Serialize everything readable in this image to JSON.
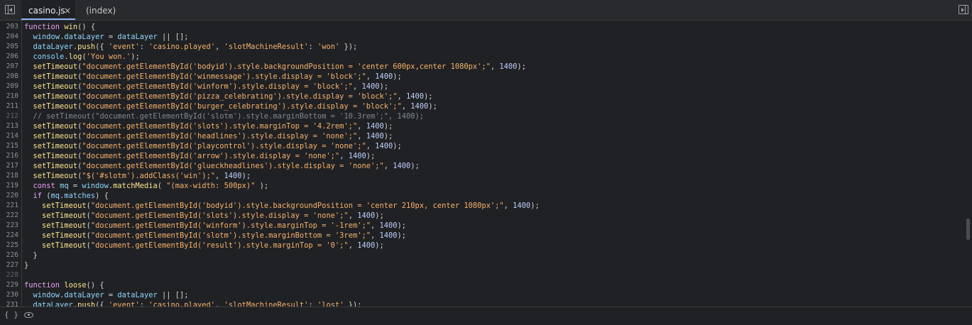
{
  "tabs": {
    "active": {
      "label": "casino.js",
      "close_glyph": "×"
    },
    "second": {
      "label": "(index)"
    }
  },
  "icons": {
    "left_panel_toggle": "left-panel-toggle-icon",
    "right_panel_toggle": "right-panel-toggle-icon",
    "braces": "braces-icon",
    "eye": "eye-icon"
  },
  "status": {
    "braces_glyph": "{ }"
  },
  "code": {
    "lines": [
      {
        "num": "203",
        "segments": [
          {
            "t": "function",
            "c": "kw"
          },
          {
            "t": " ",
            "c": "punc"
          },
          {
            "t": "win",
            "c": "fn"
          },
          {
            "t": "() {",
            "c": "punc"
          }
        ]
      },
      {
        "num": "204",
        "segments": [
          {
            "t": "  ",
            "c": "punc"
          },
          {
            "t": "window",
            "c": "prop"
          },
          {
            "t": ".",
            "c": "punc"
          },
          {
            "t": "dataLayer",
            "c": "prop"
          },
          {
            "t": " = ",
            "c": "punc"
          },
          {
            "t": "dataLayer",
            "c": "prop"
          },
          {
            "t": " || [];",
            "c": "punc"
          }
        ]
      },
      {
        "num": "205",
        "segments": [
          {
            "t": "  ",
            "c": "punc"
          },
          {
            "t": "dataLayer",
            "c": "prop"
          },
          {
            "t": ".",
            "c": "punc"
          },
          {
            "t": "push",
            "c": "fn"
          },
          {
            "t": "({ ",
            "c": "punc"
          },
          {
            "t": "'event'",
            "c": "str"
          },
          {
            "t": ": ",
            "c": "punc"
          },
          {
            "t": "'casino.played'",
            "c": "str"
          },
          {
            "t": ", ",
            "c": "punc"
          },
          {
            "t": "'slotMachineResult'",
            "c": "str"
          },
          {
            "t": ": ",
            "c": "punc"
          },
          {
            "t": "'won'",
            "c": "str"
          },
          {
            "t": " });",
            "c": "punc"
          }
        ]
      },
      {
        "num": "206",
        "segments": [
          {
            "t": "  ",
            "c": "punc"
          },
          {
            "t": "console",
            "c": "prop"
          },
          {
            "t": ".",
            "c": "punc"
          },
          {
            "t": "log",
            "c": "fn"
          },
          {
            "t": "(",
            "c": "punc"
          },
          {
            "t": "'You won.'",
            "c": "str"
          },
          {
            "t": ");",
            "c": "punc"
          }
        ]
      },
      {
        "num": "207",
        "segments": [
          {
            "t": "  ",
            "c": "punc"
          },
          {
            "t": "setTimeout",
            "c": "fn"
          },
          {
            "t": "(",
            "c": "punc"
          },
          {
            "t": "\"document.getElementById('bodyid').style.backgroundPosition = 'center 600px,center 1080px';\"",
            "c": "str"
          },
          {
            "t": ", ",
            "c": "punc"
          },
          {
            "t": "1400",
            "c": "num"
          },
          {
            "t": ");",
            "c": "punc"
          }
        ]
      },
      {
        "num": "208",
        "segments": [
          {
            "t": "  ",
            "c": "punc"
          },
          {
            "t": "setTimeout",
            "c": "fn"
          },
          {
            "t": "(",
            "c": "punc"
          },
          {
            "t": "\"document.getElementById('winmessage').style.display = 'block';\"",
            "c": "str"
          },
          {
            "t": ", ",
            "c": "punc"
          },
          {
            "t": "1400",
            "c": "num"
          },
          {
            "t": ");",
            "c": "punc"
          }
        ]
      },
      {
        "num": "209",
        "segments": [
          {
            "t": "  ",
            "c": "punc"
          },
          {
            "t": "setTimeout",
            "c": "fn"
          },
          {
            "t": "(",
            "c": "punc"
          },
          {
            "t": "\"document.getElementById('winform').style.display = 'block';\"",
            "c": "str"
          },
          {
            "t": ", ",
            "c": "punc"
          },
          {
            "t": "1400",
            "c": "num"
          },
          {
            "t": ");",
            "c": "punc"
          }
        ]
      },
      {
        "num": "210",
        "segments": [
          {
            "t": "  ",
            "c": "punc"
          },
          {
            "t": "setTimeout",
            "c": "fn"
          },
          {
            "t": "(",
            "c": "punc"
          },
          {
            "t": "\"document.getElementById('pizza_celebrating').style.display = 'block';\"",
            "c": "str"
          },
          {
            "t": ", ",
            "c": "punc"
          },
          {
            "t": "1400",
            "c": "num"
          },
          {
            "t": ");",
            "c": "punc"
          }
        ]
      },
      {
        "num": "211",
        "segments": [
          {
            "t": "  ",
            "c": "punc"
          },
          {
            "t": "setTimeout",
            "c": "fn"
          },
          {
            "t": "(",
            "c": "punc"
          },
          {
            "t": "\"document.getElementById('burger_celebrating').style.display = 'block';\"",
            "c": "str"
          },
          {
            "t": ", ",
            "c": "punc"
          },
          {
            "t": "1400",
            "c": "num"
          },
          {
            "t": ");",
            "c": "punc"
          }
        ]
      },
      {
        "num": "212",
        "dim": true,
        "segments": [
          {
            "t": "  // setTimeout(\"document.getElementById('slotm').style.marginBottom = '10.3rem';\", 1400);",
            "c": "cmt"
          }
        ]
      },
      {
        "num": "213",
        "segments": [
          {
            "t": "  ",
            "c": "punc"
          },
          {
            "t": "setTimeout",
            "c": "fn"
          },
          {
            "t": "(",
            "c": "punc"
          },
          {
            "t": "\"document.getElementById('slots').style.marginTop = '4.2rem';\"",
            "c": "str"
          },
          {
            "t": ", ",
            "c": "punc"
          },
          {
            "t": "1400",
            "c": "num"
          },
          {
            "t": ");",
            "c": "punc"
          }
        ]
      },
      {
        "num": "214",
        "segments": [
          {
            "t": "  ",
            "c": "punc"
          },
          {
            "t": "setTimeout",
            "c": "fn"
          },
          {
            "t": "(",
            "c": "punc"
          },
          {
            "t": "\"document.getElementById('headlines').style.display = 'none';\"",
            "c": "str"
          },
          {
            "t": ", ",
            "c": "punc"
          },
          {
            "t": "1400",
            "c": "num"
          },
          {
            "t": ");",
            "c": "punc"
          }
        ]
      },
      {
        "num": "215",
        "segments": [
          {
            "t": "  ",
            "c": "punc"
          },
          {
            "t": "setTimeout",
            "c": "fn"
          },
          {
            "t": "(",
            "c": "punc"
          },
          {
            "t": "\"document.getElementById('playcontrol').style.display = 'none';\"",
            "c": "str"
          },
          {
            "t": ", ",
            "c": "punc"
          },
          {
            "t": "1400",
            "c": "num"
          },
          {
            "t": ");",
            "c": "punc"
          }
        ]
      },
      {
        "num": "216",
        "segments": [
          {
            "t": "  ",
            "c": "punc"
          },
          {
            "t": "setTimeout",
            "c": "fn"
          },
          {
            "t": "(",
            "c": "punc"
          },
          {
            "t": "\"document.getElementById('arrow').style.display = 'none';\"",
            "c": "str"
          },
          {
            "t": ", ",
            "c": "punc"
          },
          {
            "t": "1400",
            "c": "num"
          },
          {
            "t": ");",
            "c": "punc"
          }
        ]
      },
      {
        "num": "217",
        "segments": [
          {
            "t": "  ",
            "c": "punc"
          },
          {
            "t": "setTimeout",
            "c": "fn"
          },
          {
            "t": "(",
            "c": "punc"
          },
          {
            "t": "\"document.getElementById('glueckheadlines').style.display = 'none';\"",
            "c": "str"
          },
          {
            "t": ", ",
            "c": "punc"
          },
          {
            "t": "1400",
            "c": "num"
          },
          {
            "t": ");",
            "c": "punc"
          }
        ]
      },
      {
        "num": "218",
        "segments": [
          {
            "t": "  ",
            "c": "punc"
          },
          {
            "t": "setTimeout",
            "c": "fn"
          },
          {
            "t": "(",
            "c": "punc"
          },
          {
            "t": "\"$('#slotm').addClass('win');\"",
            "c": "str"
          },
          {
            "t": ", ",
            "c": "punc"
          },
          {
            "t": "1400",
            "c": "num"
          },
          {
            "t": ");",
            "c": "punc"
          }
        ]
      },
      {
        "num": "219",
        "segments": [
          {
            "t": "  ",
            "c": "punc"
          },
          {
            "t": "const",
            "c": "kw"
          },
          {
            "t": " ",
            "c": "punc"
          },
          {
            "t": "mq",
            "c": "prop"
          },
          {
            "t": " = ",
            "c": "punc"
          },
          {
            "t": "window",
            "c": "prop"
          },
          {
            "t": ".",
            "c": "punc"
          },
          {
            "t": "matchMedia",
            "c": "fn"
          },
          {
            "t": "( ",
            "c": "punc"
          },
          {
            "t": "\"(max-width: 500px)\"",
            "c": "str"
          },
          {
            "t": " );",
            "c": "punc"
          }
        ]
      },
      {
        "num": "220",
        "segments": [
          {
            "t": "  ",
            "c": "punc"
          },
          {
            "t": "if",
            "c": "kw"
          },
          {
            "t": " (",
            "c": "punc"
          },
          {
            "t": "mq",
            "c": "prop"
          },
          {
            "t": ".",
            "c": "punc"
          },
          {
            "t": "matches",
            "c": "prop"
          },
          {
            "t": ") {",
            "c": "punc"
          }
        ]
      },
      {
        "num": "221",
        "segments": [
          {
            "t": "    ",
            "c": "punc"
          },
          {
            "t": "setTimeout",
            "c": "fn"
          },
          {
            "t": "(",
            "c": "punc"
          },
          {
            "t": "\"document.getElementById('bodyid').style.backgroundPosition = 'center 210px, center 1080px';\"",
            "c": "str"
          },
          {
            "t": ", ",
            "c": "punc"
          },
          {
            "t": "1400",
            "c": "num"
          },
          {
            "t": ");",
            "c": "punc"
          }
        ]
      },
      {
        "num": "222",
        "segments": [
          {
            "t": "    ",
            "c": "punc"
          },
          {
            "t": "setTimeout",
            "c": "fn"
          },
          {
            "t": "(",
            "c": "punc"
          },
          {
            "t": "\"document.getElementById('slots').style.display = 'none';\"",
            "c": "str"
          },
          {
            "t": ", ",
            "c": "punc"
          },
          {
            "t": "1400",
            "c": "num"
          },
          {
            "t": ");",
            "c": "punc"
          }
        ]
      },
      {
        "num": "223",
        "segments": [
          {
            "t": "    ",
            "c": "punc"
          },
          {
            "t": "setTimeout",
            "c": "fn"
          },
          {
            "t": "(",
            "c": "punc"
          },
          {
            "t": "\"document.getElementById('winform').style.marginTop = '-1rem';\"",
            "c": "str"
          },
          {
            "t": ", ",
            "c": "punc"
          },
          {
            "t": "1400",
            "c": "num"
          },
          {
            "t": ");",
            "c": "punc"
          }
        ]
      },
      {
        "num": "224",
        "segments": [
          {
            "t": "    ",
            "c": "punc"
          },
          {
            "t": "setTimeout",
            "c": "fn"
          },
          {
            "t": "(",
            "c": "punc"
          },
          {
            "t": "\"document.getElementById('slotm').style.marginBottom = '3rem';\"",
            "c": "str"
          },
          {
            "t": ", ",
            "c": "punc"
          },
          {
            "t": "1400",
            "c": "num"
          },
          {
            "t": ");",
            "c": "punc"
          }
        ]
      },
      {
        "num": "225",
        "segments": [
          {
            "t": "    ",
            "c": "punc"
          },
          {
            "t": "setTimeout",
            "c": "fn"
          },
          {
            "t": "(",
            "c": "punc"
          },
          {
            "t": "\"document.getElementById('result').style.marginTop = '0';\"",
            "c": "str"
          },
          {
            "t": ", ",
            "c": "punc"
          },
          {
            "t": "1400",
            "c": "num"
          },
          {
            "t": ");",
            "c": "punc"
          }
        ]
      },
      {
        "num": "226",
        "segments": [
          {
            "t": "  }",
            "c": "punc"
          }
        ]
      },
      {
        "num": "227",
        "segments": [
          {
            "t": "}",
            "c": "punc"
          }
        ]
      },
      {
        "num": "228",
        "dim": true,
        "segments": [
          {
            "t": "",
            "c": "punc"
          }
        ]
      },
      {
        "num": "229",
        "segments": [
          {
            "t": "function",
            "c": "kw"
          },
          {
            "t": " ",
            "c": "punc"
          },
          {
            "t": "loose",
            "c": "fn"
          },
          {
            "t": "() {",
            "c": "punc"
          }
        ]
      },
      {
        "num": "230",
        "segments": [
          {
            "t": "  ",
            "c": "punc"
          },
          {
            "t": "window",
            "c": "prop"
          },
          {
            "t": ".",
            "c": "punc"
          },
          {
            "t": "dataLayer",
            "c": "prop"
          },
          {
            "t": " = ",
            "c": "punc"
          },
          {
            "t": "dataLayer",
            "c": "prop"
          },
          {
            "t": " || [];",
            "c": "punc"
          }
        ]
      },
      {
        "num": "231",
        "segments": [
          {
            "t": "  ",
            "c": "punc"
          },
          {
            "t": "dataLayer",
            "c": "prop"
          },
          {
            "t": ".",
            "c": "punc"
          },
          {
            "t": "push",
            "c": "fn"
          },
          {
            "t": "({ ",
            "c": "punc"
          },
          {
            "t": "'event'",
            "c": "str"
          },
          {
            "t": ": ",
            "c": "punc"
          },
          {
            "t": "'casino.played'",
            "c": "str"
          },
          {
            "t": ", ",
            "c": "punc"
          },
          {
            "t": "'slotMachineResult'",
            "c": "str"
          },
          {
            "t": ": ",
            "c": "punc"
          },
          {
            "t": "'lost'",
            "c": "str"
          },
          {
            "t": " });",
            "c": "punc"
          }
        ]
      }
    ]
  }
}
